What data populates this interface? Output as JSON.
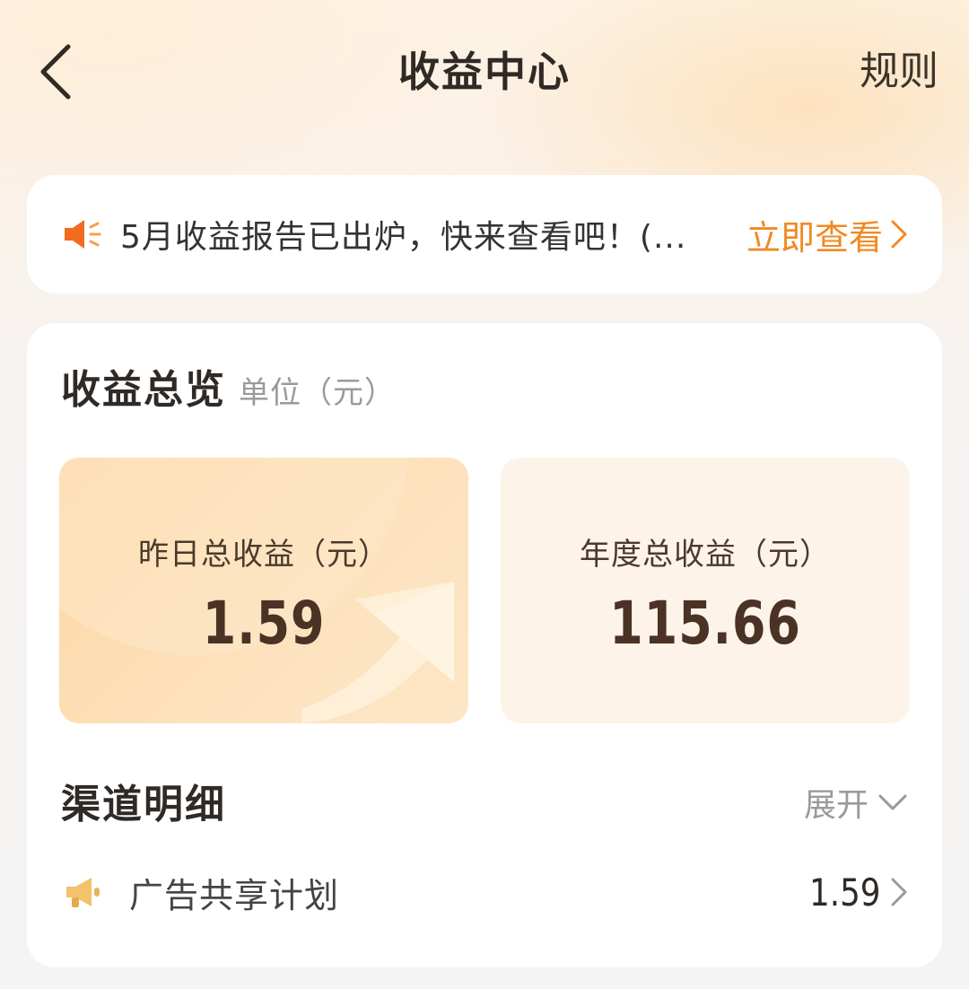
{
  "header": {
    "title": "收益中心",
    "rules_label": "规则"
  },
  "notice": {
    "text": "5月收益报告已出炉，快来查看吧！(...",
    "action_label": "立即查看"
  },
  "overview": {
    "title": "收益总览",
    "unit": "单位（元）",
    "yesterday": {
      "label": "昨日总收益（元）",
      "value": "1.59"
    },
    "year": {
      "label": "年度总收益（元）",
      "value": "115.66"
    }
  },
  "channels": {
    "title": "渠道明细",
    "expand_label": "展开",
    "items": [
      {
        "name": "广告共享计划",
        "value": "1.59"
      }
    ]
  },
  "colors": {
    "accent": "#f08a24",
    "value_text": "#4a3224",
    "card_yesterday": "#fcd7a3",
    "card_year": "#fef3e8"
  },
  "icons": {
    "back": "chevron-left-icon",
    "speaker": "speaker-icon",
    "megaphone": "megaphone-icon",
    "chevron_right": "chevron-right-icon",
    "chevron_down": "chevron-down-icon"
  }
}
